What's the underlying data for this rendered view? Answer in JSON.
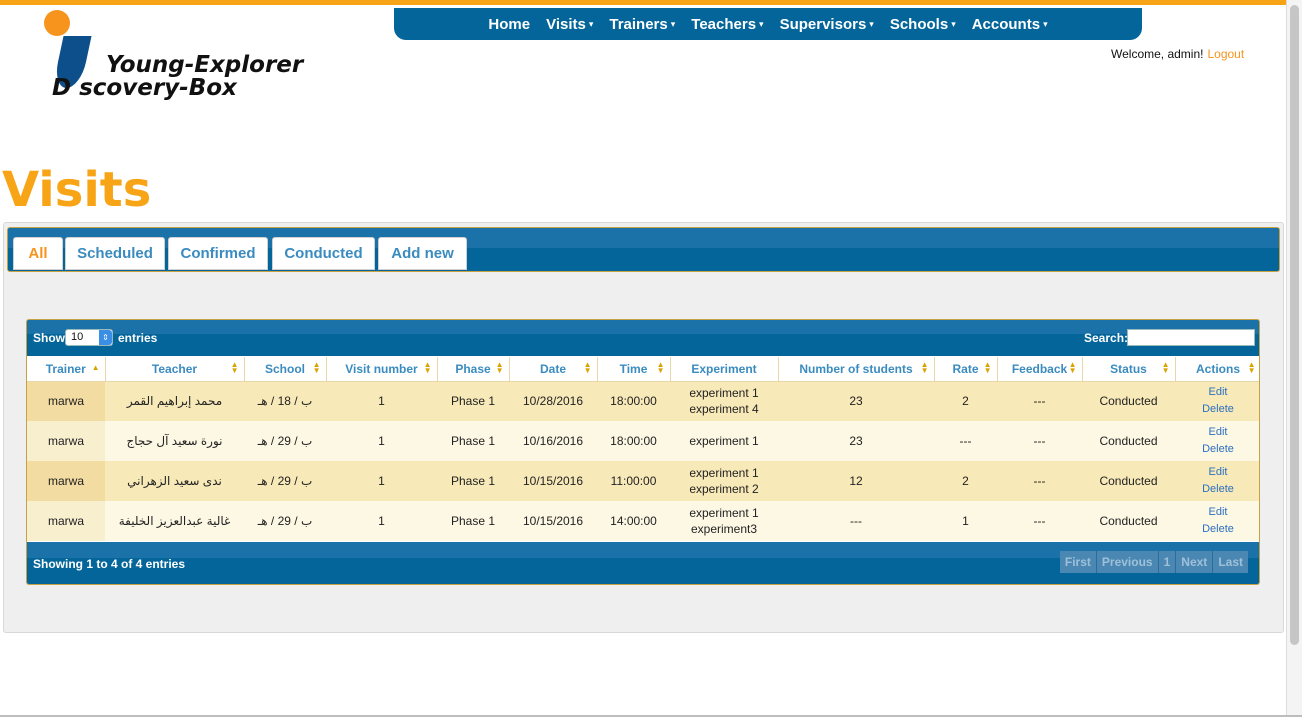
{
  "logo": {
    "line1": "Young-Explorer",
    "line2": "D scovery-Box"
  },
  "nav": [
    {
      "label": "Home",
      "caret": false
    },
    {
      "label": "Visits",
      "caret": true
    },
    {
      "label": "Trainers",
      "caret": true
    },
    {
      "label": "Teachers",
      "caret": true
    },
    {
      "label": "Supervisors",
      "caret": true
    },
    {
      "label": "Schools",
      "caret": true
    },
    {
      "label": "Accounts",
      "caret": true
    }
  ],
  "header": {
    "welcome": "Welcome, admin!",
    "logout": "Logout"
  },
  "page_title": "Visits",
  "tabs": [
    "All",
    "Scheduled",
    "Confirmed",
    "Conducted",
    "Add new"
  ],
  "table_controls": {
    "show": "Show",
    "length": "10",
    "entries": "entries",
    "search": "Search:",
    "search_value": ""
  },
  "columns": [
    "Trainer",
    "Teacher",
    "School",
    "Visit number",
    "Phase",
    "Date",
    "Time",
    "Experiment",
    "Number of students",
    "Rate",
    "Feedback",
    "Status",
    "Actions"
  ],
  "rows": [
    {
      "trainer": "marwa",
      "teacher": "محمد إبراهيم القمر",
      "school": "ب / 18 / هـ",
      "visit": "1",
      "phase": "Phase 1",
      "date": "10/28/2016",
      "time": "18:00:00",
      "exp1": "experiment 1",
      "exp2": "experiment 4",
      "students": "23",
      "rate": "2",
      "feedback": "---",
      "status": "Conducted",
      "edit": "Edit",
      "delete": "Delete"
    },
    {
      "trainer": "marwa",
      "teacher": "نورة سعيد آل حجاج",
      "school": "ب / 29 / هـ",
      "visit": "1",
      "phase": "Phase 1",
      "date": "10/16/2016",
      "time": "18:00:00",
      "exp1": "experiment 1",
      "exp2": "",
      "students": "23",
      "rate": "---",
      "feedback": "---",
      "status": "Conducted",
      "edit": "Edit",
      "delete": "Delete"
    },
    {
      "trainer": "marwa",
      "teacher": "ندى سعيد الزهراني",
      "school": "ب / 29 / هـ",
      "visit": "1",
      "phase": "Phase 1",
      "date": "10/15/2016",
      "time": "11:00:00",
      "exp1": "experiment 1",
      "exp2": "experiment 2",
      "students": "12",
      "rate": "2",
      "feedback": "---",
      "status": "Conducted",
      "edit": "Edit",
      "delete": "Delete"
    },
    {
      "trainer": "marwa",
      "teacher": "غالية عبدالعزيز الخليفة",
      "school": "ب / 29 / هـ",
      "visit": "1",
      "phase": "Phase 1",
      "date": "10/15/2016",
      "time": "14:00:00",
      "exp1": "experiment 1",
      "exp2": "experiment3",
      "students": "---",
      "rate": "1",
      "feedback": "---",
      "status": "Conducted",
      "edit": "Edit",
      "delete": "Delete"
    }
  ],
  "footer": {
    "info": "Showing 1 to 4 of 4 entries",
    "pager": [
      "First",
      "Previous",
      "1",
      "Next",
      "Last"
    ]
  },
  "colors": {
    "accent": "#f7a416",
    "nav": "#03659a",
    "link": "#3a8bbf"
  }
}
